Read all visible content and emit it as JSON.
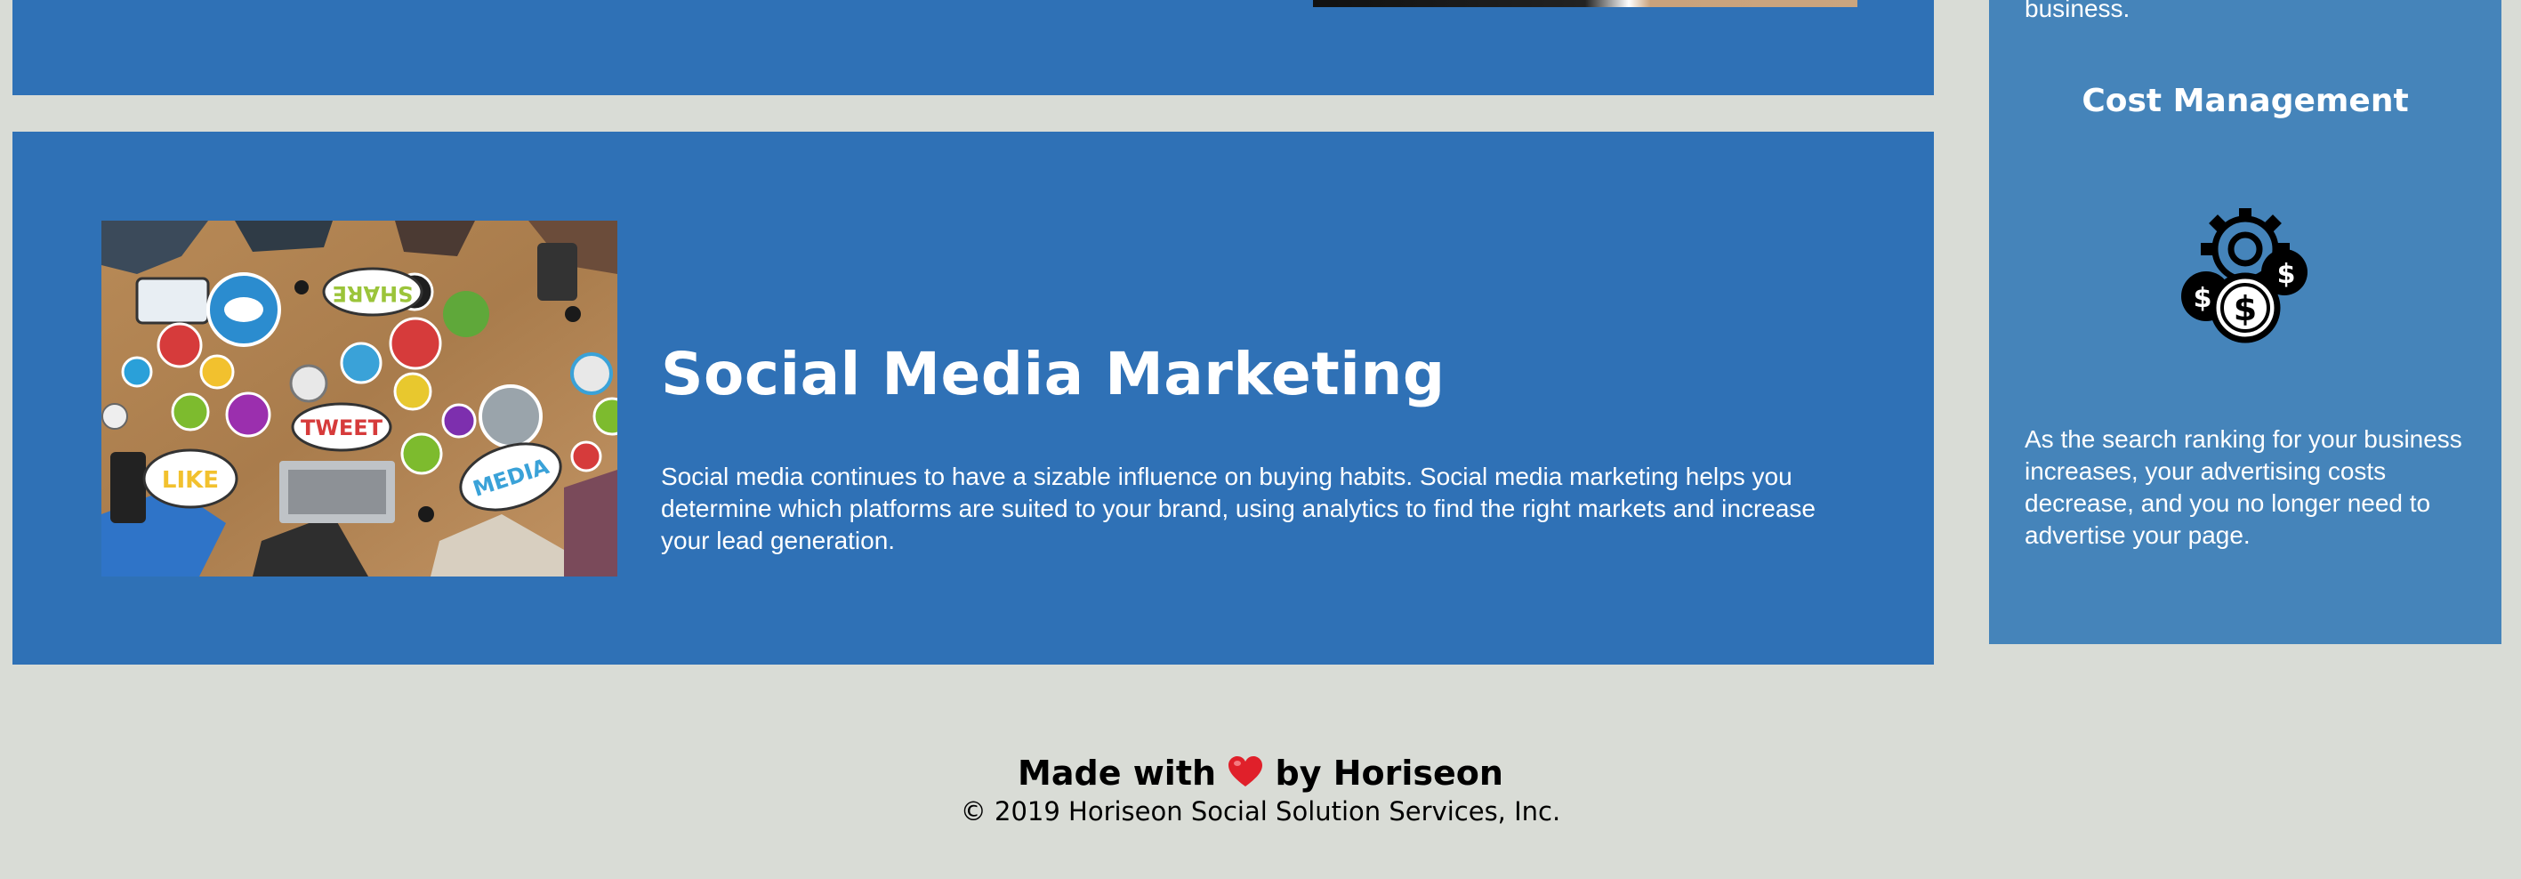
{
  "top_section": {
    "image_alt": "previous service image"
  },
  "section": {
    "title": "Social Media Marketing",
    "description": "Social media continues to have a sizable influence on buying habits. Social media marketing helps you determine which platforms are suited to your brand, using analytics to find the right markets and increase your lead generation.",
    "image_labels": {
      "share": "SHARE",
      "tweet": "TWEET",
      "like": "LIKE",
      "media": "MEDIA"
    }
  },
  "sidebar": {
    "top_text": "business.",
    "title": "Cost Management",
    "icon": "cost-management-icon",
    "text": "As the search ranking for your business increases, your advertising costs decrease, and you no longer need to advertise your page."
  },
  "footer": {
    "made_with": "Made with",
    "heart": "❤️",
    "by": "by Horiseon",
    "copyright": "© 2019 Horiseon Social Solution Services, Inc."
  },
  "colors": {
    "background": "#d9dcd6",
    "section_blue": "#2f71b6",
    "sidebar_blue": "#4584ba",
    "heart_red": "#e0202a"
  }
}
